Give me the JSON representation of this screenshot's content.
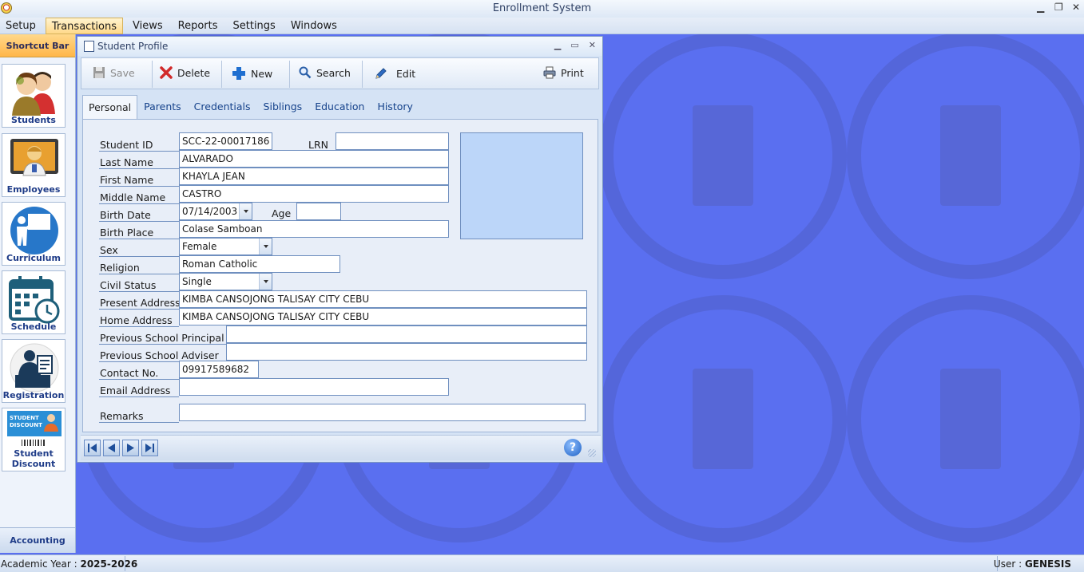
{
  "app": {
    "title": "Enrollment System"
  },
  "menu": [
    "Setup",
    "Transactions",
    "Views",
    "Reports",
    "Settings",
    "Windows"
  ],
  "shortcut_bar": {
    "header": "Shortcut Bar",
    "items": [
      "Students",
      "Employees",
      "Curriculum",
      "Schedule",
      "Registration",
      "Student Discount"
    ],
    "discount_card_text": "STUDENT DISCOUNT",
    "footer": "Accounting"
  },
  "window": {
    "title": "Student Profile",
    "toolbar": {
      "save": "Save",
      "delete": "Delete",
      "new": "New",
      "search": "Search",
      "edit": "Edit",
      "print": "Print"
    },
    "tabs": [
      "Personal",
      "Parents",
      "Credentials",
      "Siblings",
      "Education",
      "History"
    ],
    "active_tab": "Personal",
    "fields": {
      "student_id": {
        "label": "Student ID",
        "value": "SCC-22-00017186"
      },
      "lrn": {
        "label": "LRN",
        "value": ""
      },
      "last_name": {
        "label": "Last Name",
        "value": " ALVARADO"
      },
      "first_name": {
        "label": "First Name",
        "value": "KHAYLA JEAN"
      },
      "middle_name": {
        "label": "Middle Name",
        "value": "CASTRO"
      },
      "birth_date": {
        "label": "Birth Date",
        "value": "07/14/2003"
      },
      "age": {
        "label": "Age",
        "value": ""
      },
      "birth_place": {
        "label": "Birth Place",
        "value": "Colase Samboan"
      },
      "sex": {
        "label": "Sex",
        "value": "Female"
      },
      "religion": {
        "label": "Religion",
        "value": "Roman Catholic"
      },
      "civil_status": {
        "label": "Civil Status",
        "value": "Single"
      },
      "present_address": {
        "label": "Present Address",
        "value": "KIMBA CANSOJONG TALISAY CITY CEBU"
      },
      "home_address": {
        "label": "Home Address",
        "value": "KIMBA CANSOJONG TALISAY CITY CEBU"
      },
      "prev_principal": {
        "label": "Previous School Principal",
        "value": ""
      },
      "prev_adviser": {
        "label": "Previous School Adviser",
        "value": ""
      },
      "contact_no": {
        "label": "Contact No.",
        "value": "09917589682"
      },
      "email": {
        "label": "Email Address",
        "value": ""
      },
      "remarks": {
        "label": "Remarks",
        "value": ""
      }
    },
    "help": "?"
  },
  "status": {
    "academic_year_label": "Academic Year : ",
    "academic_year": "2025-2026",
    "user_label": "User : ",
    "user": "GENESIS"
  },
  "colors": {
    "desktop": "#5a6ff0",
    "accent": "#ffb648",
    "link": "#15428b"
  }
}
